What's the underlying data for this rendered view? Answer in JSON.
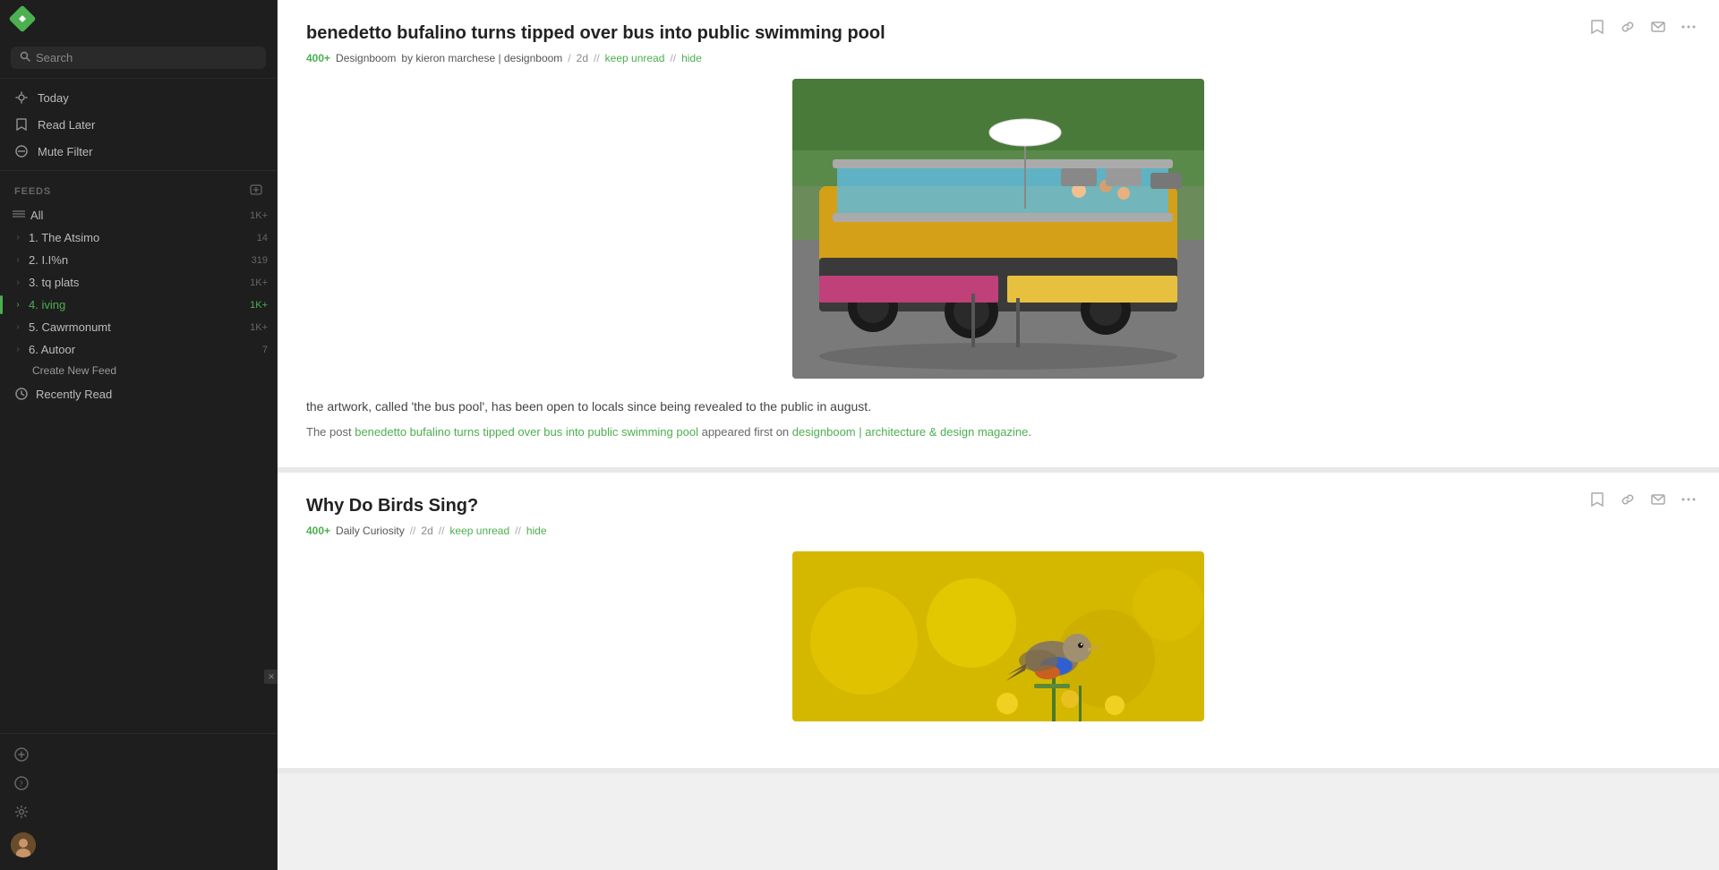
{
  "app": {
    "logo_label": "Feedly"
  },
  "sidebar": {
    "search_placeholder": "Search",
    "nav_items": [
      {
        "id": "today",
        "label": "Today",
        "icon": "sun"
      },
      {
        "id": "read-later",
        "label": "Read Later",
        "icon": "bookmark"
      },
      {
        "id": "mute-filter",
        "label": "Mute Filter",
        "icon": "clock"
      }
    ],
    "feeds_section_label": "FEEDS",
    "feed_items": [
      {
        "id": "all",
        "label": "All",
        "count": "1K+",
        "icon": "lines",
        "active": false,
        "chevron": false
      },
      {
        "id": "feed1",
        "label": "1. The Atsimo",
        "count": "14",
        "active": false,
        "chevron": true
      },
      {
        "id": "feed2",
        "label": "2. I.I%n",
        "count": "319",
        "active": false,
        "chevron": true
      },
      {
        "id": "feed3",
        "label": "3. tq plats",
        "count": "1K+",
        "active": false,
        "chevron": true
      },
      {
        "id": "feed4",
        "label": "4. iving",
        "count": "1K+",
        "active": true,
        "chevron": true
      },
      {
        "id": "feed5",
        "label": "5. Cawrmonumt",
        "count": "1K+",
        "active": false,
        "chevron": true
      },
      {
        "id": "feed6",
        "label": "6. Autoor",
        "count": "7",
        "active": false,
        "chevron": true
      }
    ],
    "feed_sub_item": "Create New Feed",
    "recently_read_label": "Recently Read",
    "bottom_actions": [
      {
        "id": "add",
        "icon": "plus"
      },
      {
        "id": "help",
        "icon": "question"
      },
      {
        "id": "settings",
        "icon": "gear"
      }
    ]
  },
  "articles": [
    {
      "id": "article1",
      "title": "benedetto bufalino turns tipped over bus into public swimming pool",
      "count": "400+",
      "source": "Designboom",
      "author": "by kieron marchese | designboom",
      "time": "2d",
      "actions": [
        "keep unread",
        "hide"
      ],
      "body": "the artwork, called 'the bus pool', has been open to locals since being revealed to the public in august.",
      "footer_pre": "The post",
      "footer_link1_text": "benedetto bufalino turns tipped over bus into public swimming pool",
      "footer_link1_href": "#",
      "footer_mid": "appeared first on",
      "footer_link2_text": "designboom | architecture & design magazine",
      "footer_link2_href": "#",
      "footer_end": ".",
      "has_image": true,
      "image_type": "bus-pool"
    },
    {
      "id": "article2",
      "title": "Why Do Birds Sing?",
      "count": "400+",
      "source": "Daily Curiosity",
      "author": "",
      "time": "2d",
      "actions": [
        "keep unread",
        "hide"
      ],
      "has_image": true,
      "image_type": "bird"
    }
  ],
  "action_icons": {
    "save": "🔖",
    "link": "🔗",
    "email": "✉",
    "more": "⋯"
  }
}
